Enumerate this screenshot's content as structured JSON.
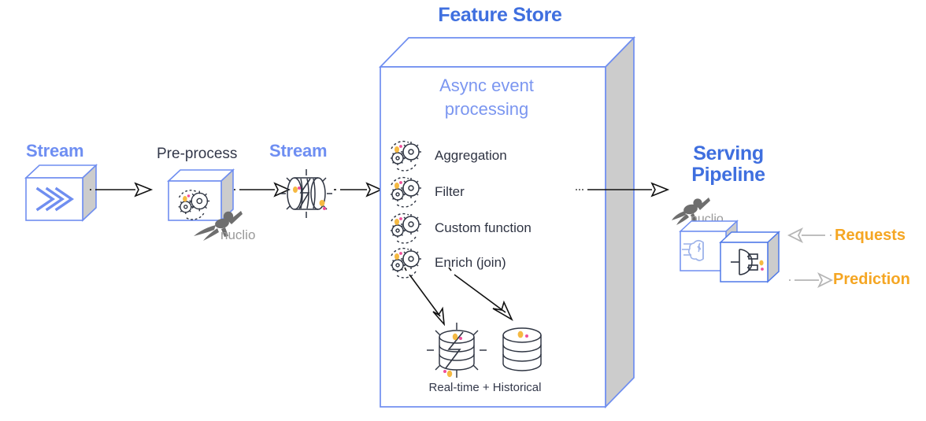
{
  "diagram": {
    "title": "Feature Store",
    "feature_store": {
      "inner_title": "Async event processing",
      "operations": [
        {
          "label": "Aggregation",
          "icon": "gears-icon"
        },
        {
          "label": "Filter",
          "icon": "gears-icon"
        },
        {
          "label": "Custom function",
          "icon": "gears-icon"
        },
        {
          "label": "Enrich (join)",
          "icon": "gears-icon"
        }
      ],
      "storage": {
        "caption": "Real-time + Historical",
        "items": [
          {
            "name": "realtime-database",
            "icon": "database-lightning-icon"
          },
          {
            "name": "historical-database",
            "icon": "database-icon"
          }
        ]
      }
    },
    "pipeline_nodes": [
      {
        "id": "stream-source",
        "label": "Stream",
        "style": "blue",
        "icon": "stream-cube-icon"
      },
      {
        "id": "pre-process",
        "label": "Pre-process",
        "style": "dark",
        "icon": "gears-cube-icon",
        "badge": "nuclio"
      },
      {
        "id": "stream-processed",
        "label": "Stream",
        "style": "blue",
        "icon": "stream-cylinder-icon"
      }
    ],
    "serving": {
      "label_line1": "Serving",
      "label_line2": "Pipeline",
      "badge": "nuclio",
      "boxes": [
        {
          "name": "model-box",
          "icon": "brain-icon"
        },
        {
          "name": "api-box",
          "icon": "plug-icon"
        }
      ]
    },
    "io": [
      {
        "id": "requests",
        "label": "Requests",
        "direction": "left"
      },
      {
        "id": "prediction",
        "label": "Prediction",
        "direction": "right"
      }
    ],
    "colors": {
      "title_blue": "#3f6fdf",
      "node_blue": "#6e8ef2",
      "inner_blue": "#7b96f0",
      "dark_text": "#33384a",
      "amber": "#f5a623",
      "box_outline": "#6f8ef0",
      "box_side": "#cccccc",
      "arrow": "#111111",
      "io_arrow": "#b5b5b5",
      "icon_ink": "#2f3542",
      "accent_orange": "#f5b942",
      "accent_pink": "#ef4f9b"
    }
  }
}
